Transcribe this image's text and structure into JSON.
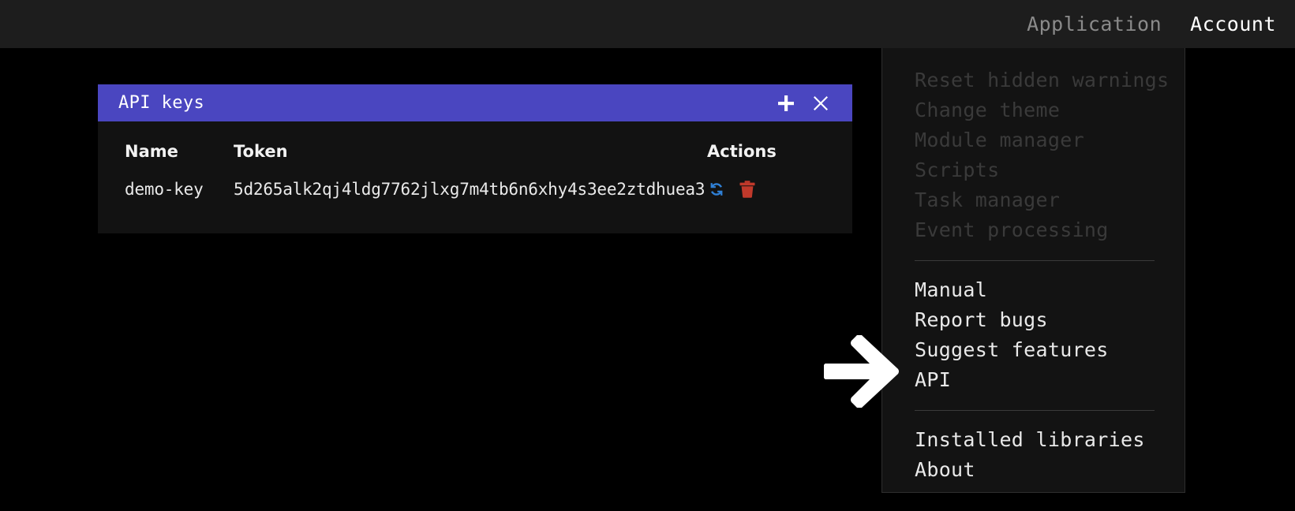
{
  "topbar": {
    "items": [
      {
        "label": "Application",
        "state": "muted"
      },
      {
        "label": "Account",
        "state": "active"
      }
    ]
  },
  "menu": {
    "groups": [
      {
        "items": [
          {
            "label": "Reset hidden warnings",
            "state": "disabled"
          },
          {
            "label": "Change theme",
            "state": "disabled"
          },
          {
            "label": "Module manager",
            "state": "disabled"
          },
          {
            "label": "Scripts",
            "state": "disabled"
          },
          {
            "label": "Task manager",
            "state": "disabled"
          },
          {
            "label": "Event processing",
            "state": "disabled"
          }
        ]
      },
      {
        "items": [
          {
            "label": "Manual",
            "state": "enabled"
          },
          {
            "label": "Report bugs",
            "state": "enabled"
          },
          {
            "label": "Suggest features",
            "state": "enabled"
          },
          {
            "label": "API",
            "state": "enabled"
          }
        ]
      },
      {
        "items": [
          {
            "label": "Installed libraries",
            "state": "enabled"
          },
          {
            "label": "About",
            "state": "enabled"
          }
        ]
      }
    ]
  },
  "dialog": {
    "title": "API keys",
    "add_icon": "plus-icon",
    "close_icon": "close-icon",
    "table": {
      "headers": [
        "Name",
        "Token",
        "Actions"
      ],
      "rows": [
        {
          "name": "demo-key",
          "token": "5d265alk2qj4ldg7762jlxg7m4tb6n6xhy4s3ee2ztdhuea3",
          "actions": [
            "regenerate-icon",
            "delete-icon"
          ]
        }
      ]
    }
  },
  "annotation": {
    "arrow_icon": "arrow-right-icon"
  },
  "colors": {
    "accent": "#4a46c0",
    "regenerate": "#2f80d6",
    "delete": "#c0392b",
    "page_background": "#000000",
    "topbar_background": "#1d1d1d",
    "menu_background": "#131313",
    "dialog_background": "#121212"
  }
}
